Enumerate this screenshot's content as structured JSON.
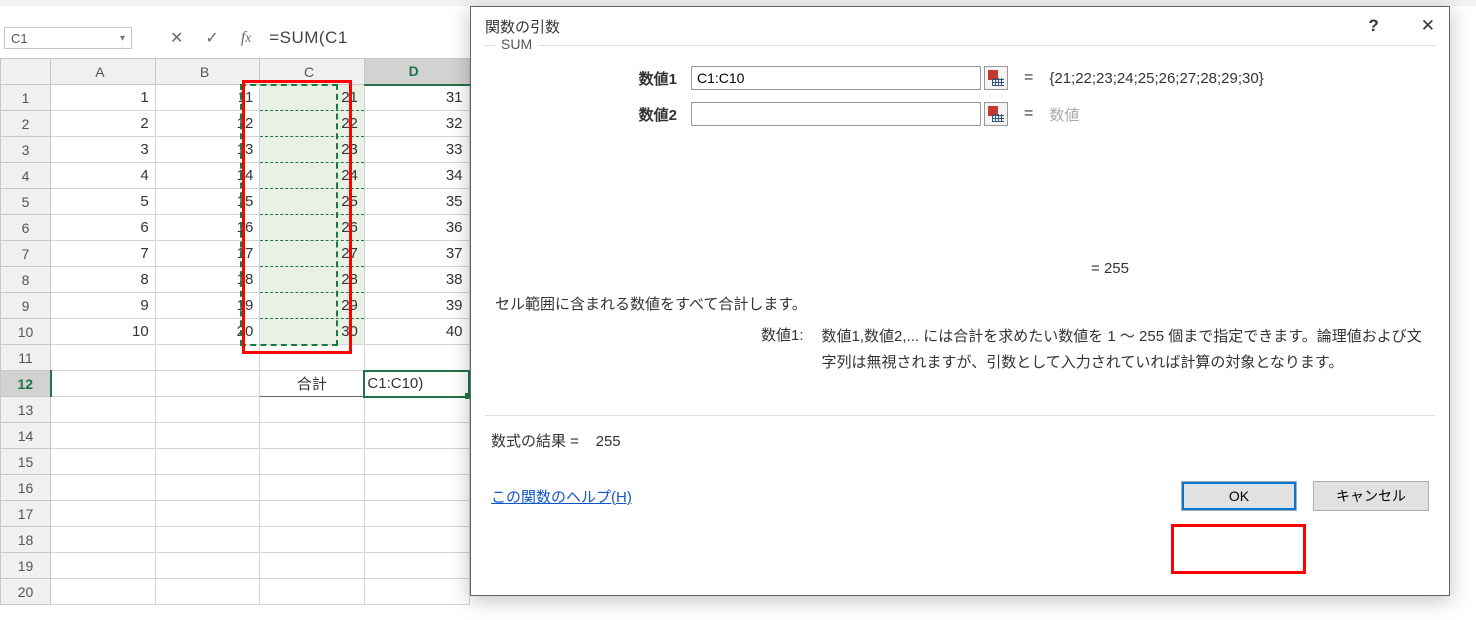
{
  "formulaBar": {
    "nameBox": "C1",
    "formula": "=SUM(C1"
  },
  "columns": [
    "A",
    "B",
    "C",
    "D"
  ],
  "rows": [
    {
      "n": 1,
      "A": 1,
      "B": 11,
      "C": 21,
      "D": 31
    },
    {
      "n": 2,
      "A": 2,
      "B": 12,
      "C": 22,
      "D": 32
    },
    {
      "n": 3,
      "A": 3,
      "B": 13,
      "C": 23,
      "D": 33
    },
    {
      "n": 4,
      "A": 4,
      "B": 14,
      "C": 24,
      "D": 34
    },
    {
      "n": 5,
      "A": 5,
      "B": 15,
      "C": 25,
      "D": 35
    },
    {
      "n": 6,
      "A": 6,
      "B": 16,
      "C": 26,
      "D": 36
    },
    {
      "n": 7,
      "A": 7,
      "B": 17,
      "C": 27,
      "D": 37
    },
    {
      "n": 8,
      "A": 8,
      "B": 18,
      "C": 28,
      "D": 38
    },
    {
      "n": 9,
      "A": 9,
      "B": 19,
      "C": 29,
      "D": 39
    },
    {
      "n": 10,
      "A": 10,
      "B": 20,
      "C": 30,
      "D": 40
    }
  ],
  "sumRow": {
    "n": 12,
    "labelCell": "合計",
    "formulaCell": "C1:C10)"
  },
  "extraRowNums": [
    11,
    12,
    13,
    14,
    15,
    16,
    17,
    18,
    19,
    20
  ],
  "dialog": {
    "title": "関数の引数",
    "funcName": "SUM",
    "args": [
      {
        "label": "数値1",
        "value": "C1:C10",
        "result": "{21;22;23;24;25;26;27;28;29;30}"
      },
      {
        "label": "数値2",
        "value": "",
        "result": "数値"
      }
    ],
    "interimResult": "= 255",
    "desc1": "セル範囲に含まれる数値をすべて合計します。",
    "descArgLabel": "数値1:",
    "descArgText": "数値1,数値2,... には合計を求めたい数値を 1 ～ 255 個まで指定できます。論理値および文字列は無視されますが、引数として入力されていれば計算の対象となります。",
    "formulaResultLabel": "数式の結果 =",
    "formulaResultValue": "255",
    "helpLink": "この関数のヘルプ(H)",
    "okButton": "OK",
    "cancelButton": "キャンセル",
    "helpIcon": "?",
    "closeIcon": "✕"
  }
}
